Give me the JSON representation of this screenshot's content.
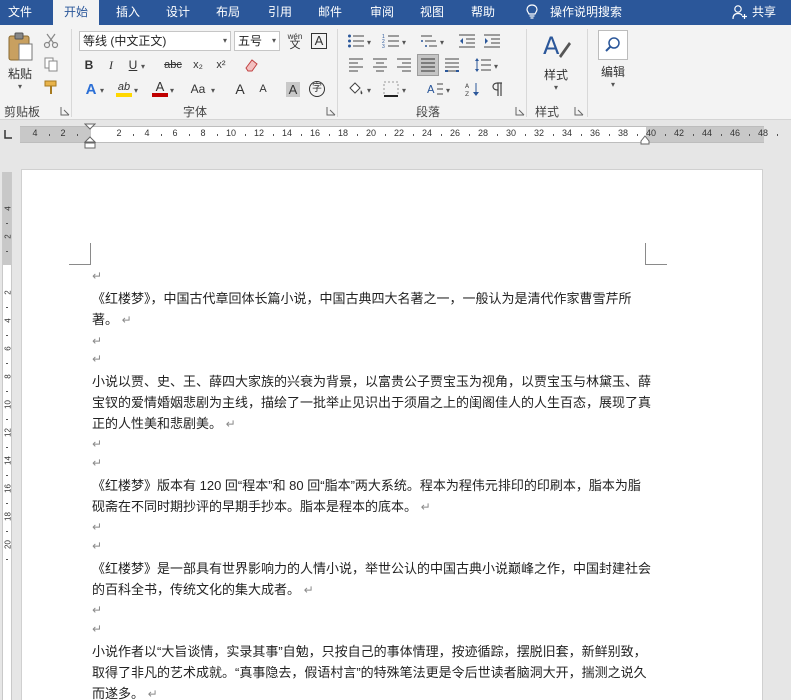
{
  "tabs": [
    "文件",
    "开始",
    "插入",
    "设计",
    "布局",
    "引用",
    "邮件",
    "审阅",
    "视图",
    "帮助"
  ],
  "active_tab": "开始",
  "tell_me": "操作说明搜索",
  "share": "共享",
  "ribbon": {
    "clipboard": {
      "paste_label": "粘贴",
      "group_label": "剪贴板"
    },
    "font": {
      "font_name": "等线 (中文正文)",
      "font_size": "五号",
      "wen_pinyin": "wén",
      "wen_char": "文",
      "boxed_a": "A",
      "bold": "B",
      "italic": "I",
      "underline": "U",
      "strike": "abc",
      "subscript": "x₂",
      "superscript": "x²",
      "text_effect": "A",
      "highlight": "ab",
      "font_color": "A",
      "aa_label": "Aa",
      "grow": "A",
      "shrink": "A",
      "char_shading": "A",
      "enclose": "字",
      "group_label": "字体"
    },
    "paragraph": {
      "group_label": "段落"
    },
    "styles": {
      "label": "样式",
      "group_label": "样式"
    },
    "editing": {
      "label": "编辑"
    }
  },
  "ruler": {
    "h_numbers": [
      "4",
      "2",
      "2",
      "4",
      "6",
      "8",
      "10",
      "12",
      "14",
      "16",
      "18",
      "20",
      "22",
      "24",
      "26",
      "28",
      "30",
      "32",
      "34",
      "36",
      "38",
      "40",
      "42",
      "44",
      "46",
      "48"
    ],
    "v_numbers": [
      "4",
      "2",
      "2",
      "4",
      "6",
      "8",
      "10",
      "12",
      "14",
      "16",
      "18",
      "20"
    ]
  },
  "document": {
    "para_mark": "↵",
    "paragraphs": [
      "《红楼梦》，中国古代章回体长篇小说，中国古典四大名著之一，一般认为是清代作家曹雪芹所著。",
      "小说以贾、史、王、薛四大家族的兴衰为背景，以富贵公子贾宝玉为视角，以贾宝玉与林黛玉、薛宝钗的爱情婚姻悲剧为主线，描绘了一批举止见识出于须眉之上的闺阁佳人的人生百态，展现了真正的人性美和悲剧美。",
      "《红楼梦》版本有 120 回“程本”和 80 回“脂本”两大系统。程本为程伟元排印的印刷本，脂本为脂砚斋在不同时期抄评的早期手抄本。脂本是程本的底本。",
      "《红楼梦》是一部具有世界影响力的人情小说，举世公认的中国古典小说巅峰之作，中国封建社会的百科全书，传统文化的集大成者。",
      "小说作者以“大旨谈情，实录其事”自勉，只按自己的事体情理，按迹循踪，摆脱旧套，新鲜别致，取得了非凡的艺术成就。“真事隐去，假语村言”的特殊笔法更是令后世读者脑洞大开，揣测之说久而遂多。"
    ]
  },
  "colors": {
    "brand": "#2b579a",
    "highlight": "#ffd700",
    "font_color": "#c00000",
    "text_effect": "#2b6fd6"
  }
}
